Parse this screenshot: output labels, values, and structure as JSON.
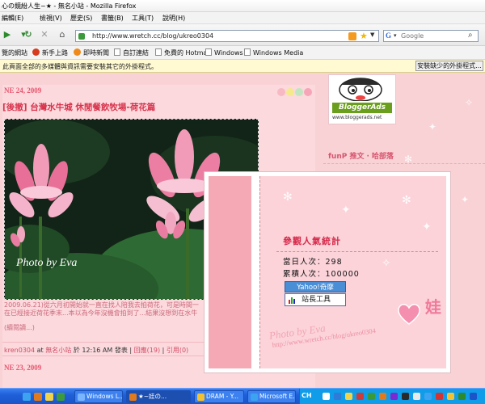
{
  "window": {
    "title": "心の鏡紛人生~★ - 無名小站 - Mozilla Firefox"
  },
  "menu": [
    "編輯(E)",
    "檢視(V)",
    "歷史(S)",
    "書籤(B)",
    "工具(T)",
    "說明(H)"
  ],
  "nav": {
    "url": "http://www.wretch.cc/blog/ukreo0304",
    "search_placeholder": "Google"
  },
  "bookmarks": [
    "覽的網站",
    "新手上路",
    "即時新聞",
    "自訂連結",
    "免費的 Hotmail",
    "Windows",
    "Windows Media"
  ],
  "infobar": {
    "message": "此頁面全部的多媒體與資訊需要安裝其它的外掛程式。",
    "button": "安裝缺少的外掛程式..."
  },
  "post": {
    "date": "NE 24, 2009",
    "title": "[後撤] 台灣水牛城 休閒餐飲牧場-荷花篇",
    "photo_caption": "Photo by Eva",
    "excerpt_line1": "2009.06.21)從六月初開始就一直在找人陪我去拍荷花，可是時間一",
    "excerpt_line2": "在已經接近荷花季末...本以為今年沒機會拍到了...結果沒想到在水牛",
    "read_more": "(續閱讀...)",
    "author": "kren0304",
    "at_label": "at",
    "site": "無名小站",
    "time_text": "於 12:16 AM 發表",
    "reply": "回應(19)",
    "quote": "引用(0)",
    "next_date": "NE 23, 2009"
  },
  "sidebar": {
    "ads_logo": "BloggerAds",
    "ads_url": "www.bloggerads.net",
    "funp": "funP 推文 ‧ 哈部落"
  },
  "counter": {
    "title": "參觀人氣統計",
    "today_label": "當日人次：",
    "today_value": "298",
    "total_label": "累積人次：",
    "total_value": "100000",
    "yahoo_button": "Yahoo!奇摩",
    "webmaster_button": "站長工具",
    "wa": "娃",
    "watermark_photo": "Photo by Eva",
    "watermark_url": "http://www.wretch.cc/blog/ukreo0304"
  },
  "taskbar": {
    "items": [
      "Windows L...",
      "★~娃の...",
      "DRAM - Y...",
      "Microsoft E..."
    ],
    "lang": "CH"
  },
  "colors": {
    "page_bg": "#f9d2d6",
    "accent_pink": "#d8344d",
    "taskbar_blue": "#1f5fd8"
  }
}
